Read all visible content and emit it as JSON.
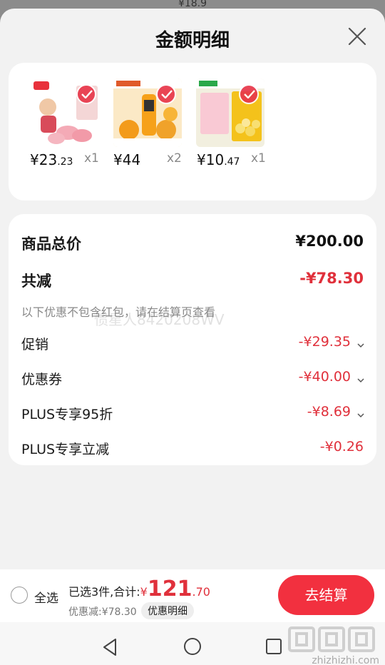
{
  "peek_text": "¥18.9",
  "title": "金额明细",
  "products": [
    {
      "price_main": "¥23",
      "price_small": ".23",
      "qty": "x1",
      "thumb_color": "#ffffff"
    },
    {
      "price_main": "¥44",
      "price_small": "",
      "qty": "x2",
      "thumb_color": "#f7a31c"
    },
    {
      "price_main": "¥10",
      "price_small": ".47",
      "qty": "x1",
      "thumb_color": "#f5e4a8"
    }
  ],
  "summary": {
    "total_label": "商品总价",
    "total_value": "¥200.00",
    "reduce_label": "共减",
    "reduce_value": "-¥78.30",
    "hint": "以下优惠不包含红包，请在结算页查看",
    "watermark": "惯星人8420208WV",
    "items": [
      {
        "label": "促销",
        "value": "-¥29.35",
        "expandable": true
      },
      {
        "label": "优惠券",
        "value": "-¥40.00",
        "expandable": true
      },
      {
        "label": "PLUS专享95折",
        "value": "-¥8.69",
        "expandable": true
      },
      {
        "label": "PLUS专享立减",
        "value": "-¥0.26",
        "expandable": false
      }
    ]
  },
  "bottom": {
    "select_all": "全选",
    "selected_total_label": "已选3件,合计:",
    "currency": "¥",
    "total_int": "121",
    "total_cents": ".70",
    "discount_text": "优惠减:¥78.30",
    "detail_label": "优惠明细",
    "checkout_label": "去结算"
  },
  "brand_text": "zhizhizhi.com",
  "colors": {
    "accent": "#e0303b",
    "button": "#f2303f",
    "sheet_bg": "#f2f2f2"
  }
}
